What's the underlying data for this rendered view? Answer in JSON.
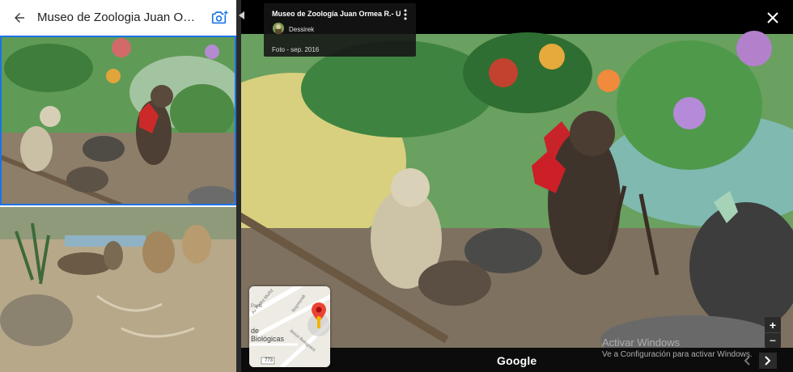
{
  "header": {
    "place_title": "Museo de Zoologia Juan Ormea ...",
    "back_icon": "arrow-left-icon",
    "add_photo_icon": "add-photo-icon"
  },
  "photo_info": {
    "title": "Museo de Zoología Juan Ormea R.- UNT",
    "author": "Dessirek",
    "date": "Foto - sep. 2016"
  },
  "minimap": {
    "street_1": "Av Pedro Muñiz",
    "street_2": "Raymondi",
    "street_3": "Jesús Bolognesi",
    "label_paris": "París",
    "label_biologicas": "de Biológicas",
    "route_badge": "773"
  },
  "viewer": {
    "brand": "Google",
    "watermark_line1": "Activar Windows",
    "watermark_line2": "Ve a Configuración para activar Windows.",
    "zoom_in_label": "+",
    "zoom_out_label": "−"
  },
  "colors": {
    "accent": "#1a73e8",
    "pin": "#ea4335",
    "pegman": "#f4b400"
  }
}
